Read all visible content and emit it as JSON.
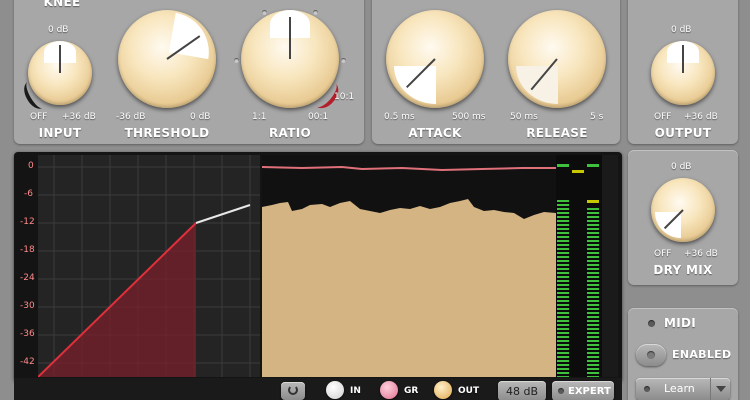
{
  "top": {
    "knee": {
      "label": "KNEE"
    },
    "input": {
      "label": "INPUT",
      "top": "0 dB",
      "min": "OFF",
      "max": "+36 dB"
    },
    "threshold": {
      "label": "THRESHOLD",
      "min": "-36 dB",
      "max": "0 dB"
    },
    "ratio": {
      "label": "RATIO",
      "min": "1:1",
      "max": "00:1",
      "marker": "10:1"
    },
    "attack": {
      "label": "ATTACK",
      "min": "0.5 ms",
      "max": "500 ms"
    },
    "release": {
      "label": "RELEASE",
      "min": "50 ms",
      "max": "5 s"
    },
    "output": {
      "label": "OUTPUT",
      "top": "0 dB",
      "min": "OFF",
      "max": "+36 dB"
    },
    "drymix": {
      "label": "DRY MIX",
      "top": "0 dB",
      "min": "OFF",
      "max": "+36 dB"
    }
  },
  "db_scale": [
    "0",
    "-6",
    "-12",
    "-18",
    "-24",
    "-30",
    "-36",
    "-42"
  ],
  "bottom": {
    "in_label": "IN",
    "gr_label": "GR",
    "out_label": "OUT",
    "range_label": "48 dB",
    "expert_label": "EXPERT"
  },
  "side": {
    "midi_label": "MIDI",
    "enabled_label": "ENABLED",
    "learn_label": "Learn"
  },
  "colors": {
    "curve": "#d42a36",
    "waveform": "#d4b483",
    "gr_line": "#e0707a"
  }
}
